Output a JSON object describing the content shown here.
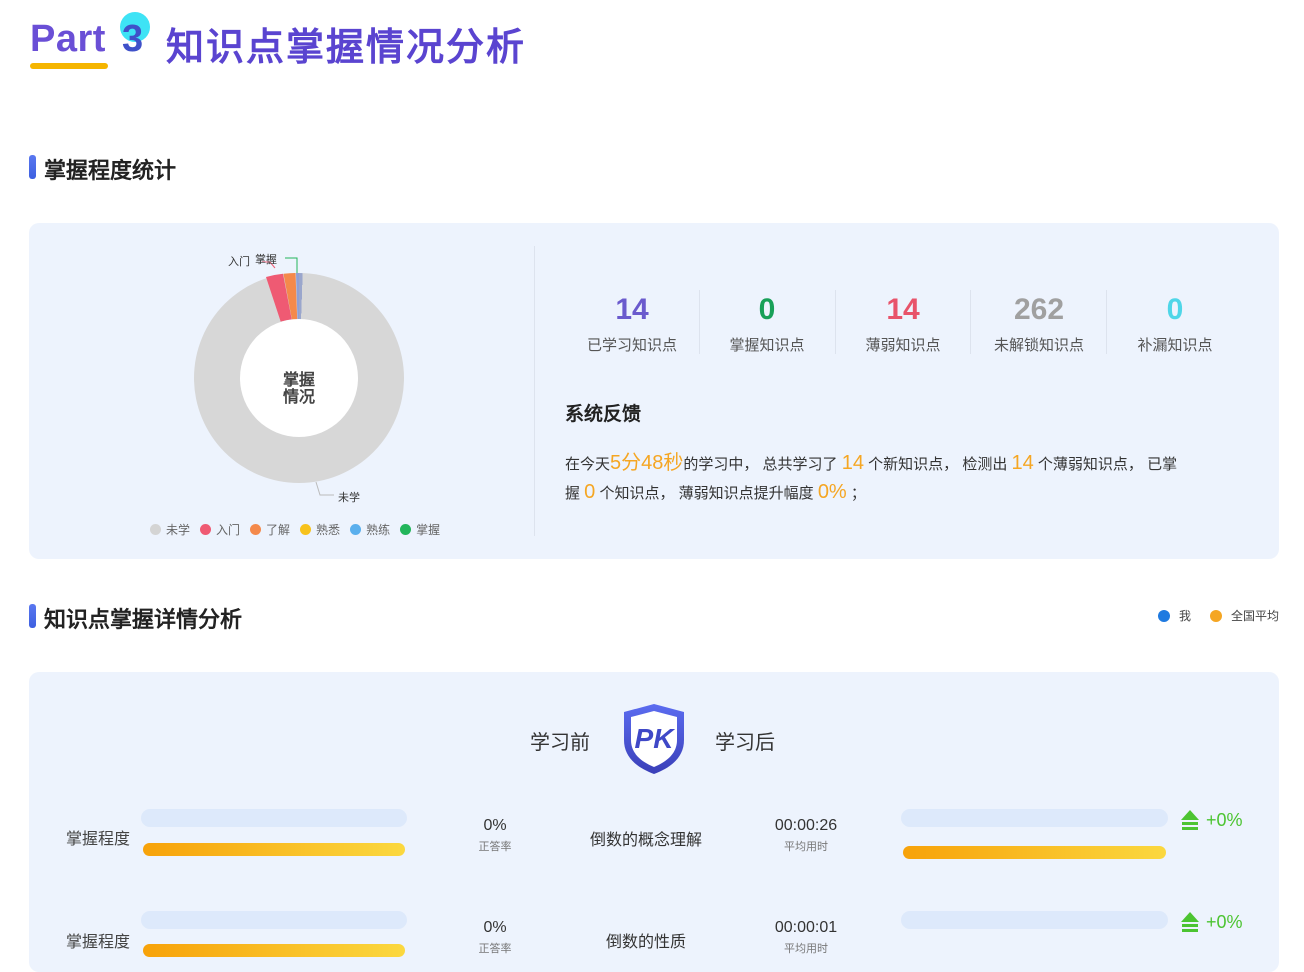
{
  "header": {
    "part_word": "Part",
    "part_number": "3",
    "title": "知识点掌握情况分析"
  },
  "section1": {
    "title": "掌握程度统计",
    "donut": {
      "center_label_line1": "掌握",
      "center_label_line2": "情况",
      "label_rumen": "入门",
      "label_zhangwo": "掌握",
      "label_weixue": "未学"
    },
    "legend": [
      {
        "label": "未学",
        "color": "#d4d4d4"
      },
      {
        "label": "入门",
        "color": "#ef5a73"
      },
      {
        "label": "了解",
        "color": "#f4894b"
      },
      {
        "label": "熟悉",
        "color": "#f7c21c"
      },
      {
        "label": "熟练",
        "color": "#5aafed"
      },
      {
        "label": "掌握",
        "color": "#22b55b"
      }
    ],
    "stats": [
      {
        "value": "14",
        "label": "已学习知识点",
        "color": "#6a5acd"
      },
      {
        "value": "0",
        "label": "掌握知识点",
        "color": "#18a058"
      },
      {
        "value": "14",
        "label": "薄弱知识点",
        "color": "#e8536a"
      },
      {
        "value": "262",
        "label": "未解锁知识点",
        "color": "#a0a0a0"
      },
      {
        "value": "0",
        "label": "补漏知识点",
        "color": "#4fd6e8"
      }
    ],
    "feedback": {
      "title": "系统反馈",
      "t1": "在今天",
      "h1": "5分48秒",
      "t2": "的学习中， 总共学习了 ",
      "h2": "14",
      "t3": " 个新知识点， 检测出 ",
      "h3": "14",
      "t4": " 个薄弱知识点， 已掌",
      "t5": "握 ",
      "h4": "0",
      "t6": " 个知识点， 薄弱知识点提升幅度 ",
      "h5": "0%",
      "t7": " ；"
    }
  },
  "section2": {
    "title": "知识点掌握详情分析",
    "legend": [
      {
        "label": "我",
        "color": "#1f7ae0"
      },
      {
        "label": "全国平均",
        "color": "#f5a623"
      }
    ],
    "pk": {
      "before": "学习前",
      "after": "学习后",
      "logo": "PK"
    },
    "rows": [
      {
        "label": "掌握程度",
        "rate": "0%",
        "rate_label": "正答率",
        "name": "倒数的概念理解",
        "time": "00:00:26",
        "time_label": "平均用时",
        "change": "+0%"
      },
      {
        "label": "掌握程度",
        "rate": "0%",
        "rate_label": "正答率",
        "name": "倒数的性质",
        "time": "00:00:01",
        "time_label": "平均用时",
        "change": "+0%"
      }
    ]
  }
}
